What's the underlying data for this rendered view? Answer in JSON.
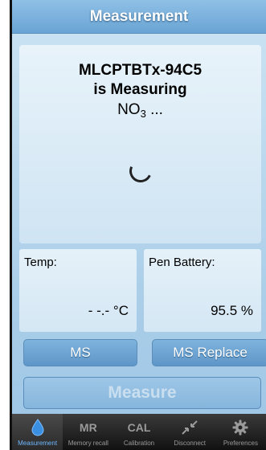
{
  "header": {
    "title": "Measurement"
  },
  "status": {
    "device": "MLCPTBTx-94C5",
    "measuring": "is Measuring",
    "param_main": "NO",
    "param_sub": "3",
    "param_suffix": " ..."
  },
  "temp": {
    "label": "Temp:",
    "value": "- -.- °C"
  },
  "battery": {
    "label": "Pen Battery:",
    "value": "95.5 %"
  },
  "buttons": {
    "ms": "MS",
    "ms_replace": "MS Replace",
    "measure": "Measure"
  },
  "tabs": [
    {
      "label": "Measurement",
      "icon": "water-drop-icon",
      "active": true
    },
    {
      "label": "Memory recall",
      "icon_text": "MR"
    },
    {
      "label": "Calibration",
      "icon_text": "CAL"
    },
    {
      "label": "Disconnect",
      "icon": "disconnect-arrows-icon"
    },
    {
      "label": "Preferences",
      "icon": "gear-icon"
    }
  ],
  "colors": {
    "tab_active": "#6fb8ff",
    "drop": "#3a8fe0",
    "header": "#6aa4d4"
  }
}
